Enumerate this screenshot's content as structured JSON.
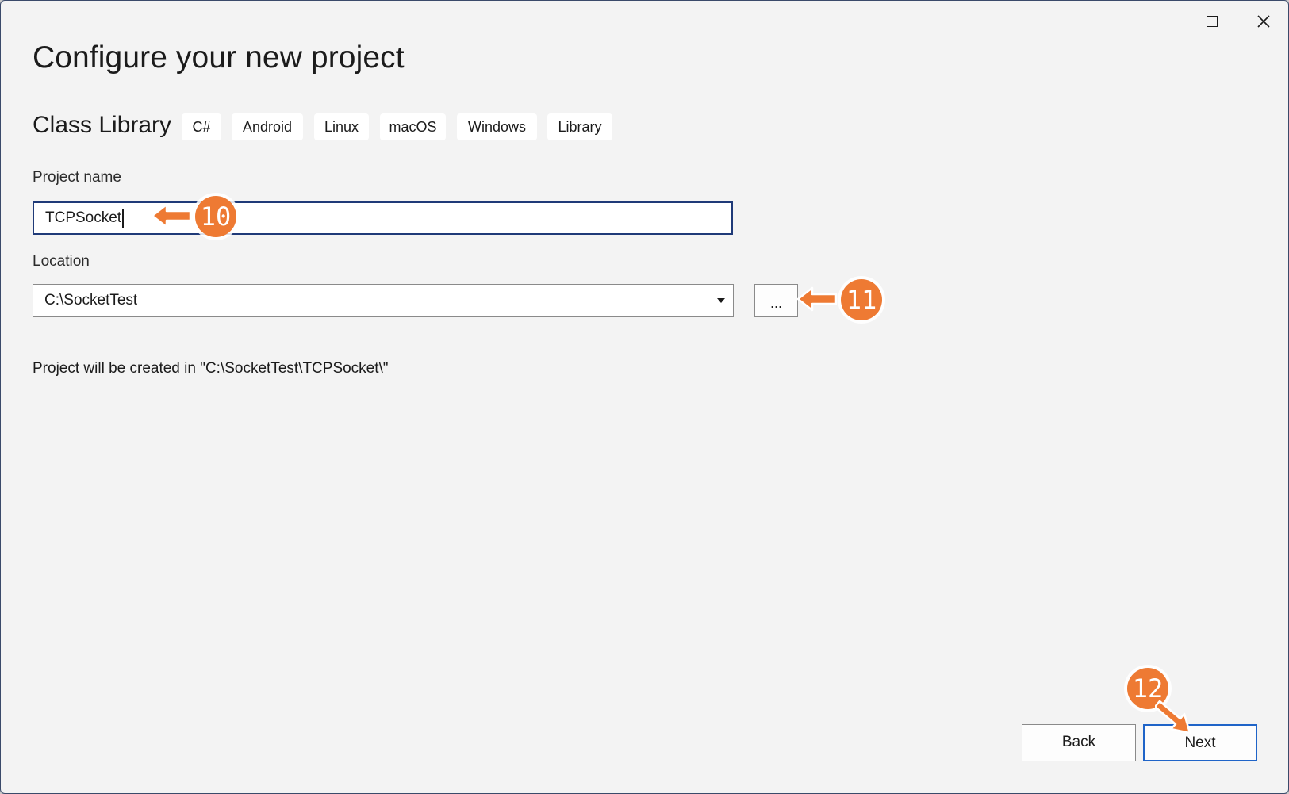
{
  "window": {
    "title": "Configure your new project"
  },
  "template": {
    "name": "Class Library",
    "tags": [
      "C#",
      "Android",
      "Linux",
      "macOS",
      "Windows",
      "Library"
    ]
  },
  "project_name": {
    "label": "Project name",
    "value": "TCPSocket"
  },
  "location": {
    "label": "Location",
    "value": "C:\\SocketTest",
    "browse_label": "..."
  },
  "path_note": "Project will be created in \"C:\\SocketTest\\TCPSocket\\\"",
  "buttons": {
    "back": "Back",
    "next": "Next"
  },
  "callouts": {
    "c10": "10",
    "c11": "11",
    "c12": "12",
    "color": "#ee7a33"
  },
  "icons": {
    "maximize": "maximize-icon",
    "close": "close-icon",
    "dropdown": "chevron-down-icon"
  }
}
